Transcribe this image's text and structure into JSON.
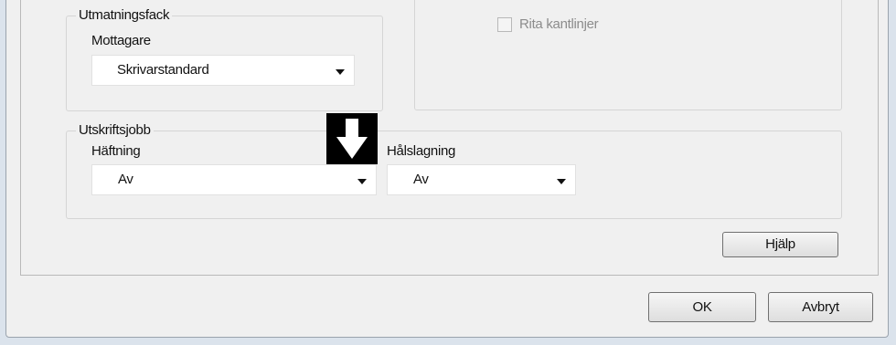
{
  "output_tray": {
    "group_title": "Utmatningsfack",
    "recipient_label": "Mottagare",
    "recipient_value": "Skrivarstandard"
  },
  "options": {
    "draw_borders_label": "Rita kantlinjer",
    "draw_borders_checked": false,
    "draw_borders_enabled": false
  },
  "print_job": {
    "group_title": "Utskriftsjobb",
    "stapling_label": "Häftning",
    "stapling_value": "Av",
    "hole_punch_label": "Hålslagning",
    "hole_punch_value": "Av"
  },
  "buttons": {
    "help": "Hjälp",
    "ok": "OK",
    "cancel": "Avbryt"
  },
  "icons": {
    "marker": "down-arrow-icon"
  }
}
